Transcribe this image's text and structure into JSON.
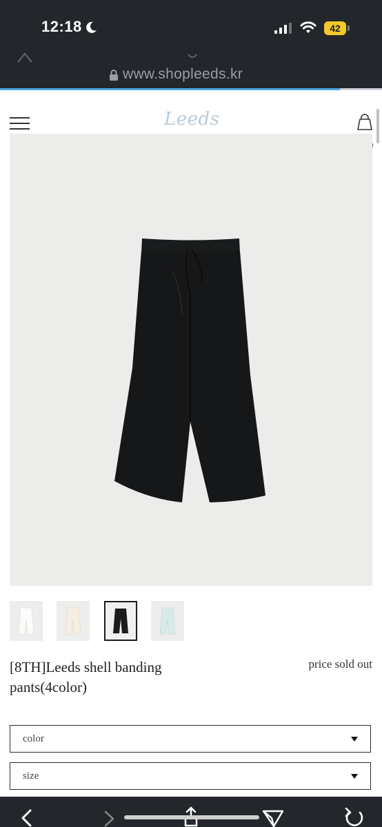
{
  "status_bar": {
    "time": "12:18",
    "battery": "42"
  },
  "browser": {
    "url": "www.shopleeds.kr",
    "url_ghost": ""
  },
  "page_load": {
    "progress_fraction": 0.89
  },
  "site": {
    "logo": "Leeds"
  },
  "product": {
    "title": "[8TH]Leeds shell banding pants(4color)",
    "price_status": "price sold out",
    "thumbnails": [
      {
        "color": "#f7f7f5",
        "selected": false
      },
      {
        "color": "#f3ede2",
        "selected": false
      },
      {
        "color": "#1b1b1c",
        "selected": true
      },
      {
        "color": "#d9ebe8",
        "selected": false
      }
    ]
  },
  "options": {
    "color_label": "color",
    "size_label": "size"
  },
  "colors": {
    "browser_bar": "#23262b",
    "progress": "#4ea7e8",
    "battery": "#f2c82b",
    "logo": "#b8cbd6",
    "image_bg": "#ececeb",
    "pants": "#161718"
  },
  "icons": {
    "status": [
      "moon-icon",
      "signal-icon",
      "wifi-icon",
      "battery-icon"
    ],
    "header": [
      "menu-icon",
      "bag-icon",
      "heart-icon"
    ],
    "bottom": [
      "back-arrow-icon",
      "forward-arrow-icon",
      "share-icon",
      "send-icon",
      "refresh-icon"
    ]
  }
}
